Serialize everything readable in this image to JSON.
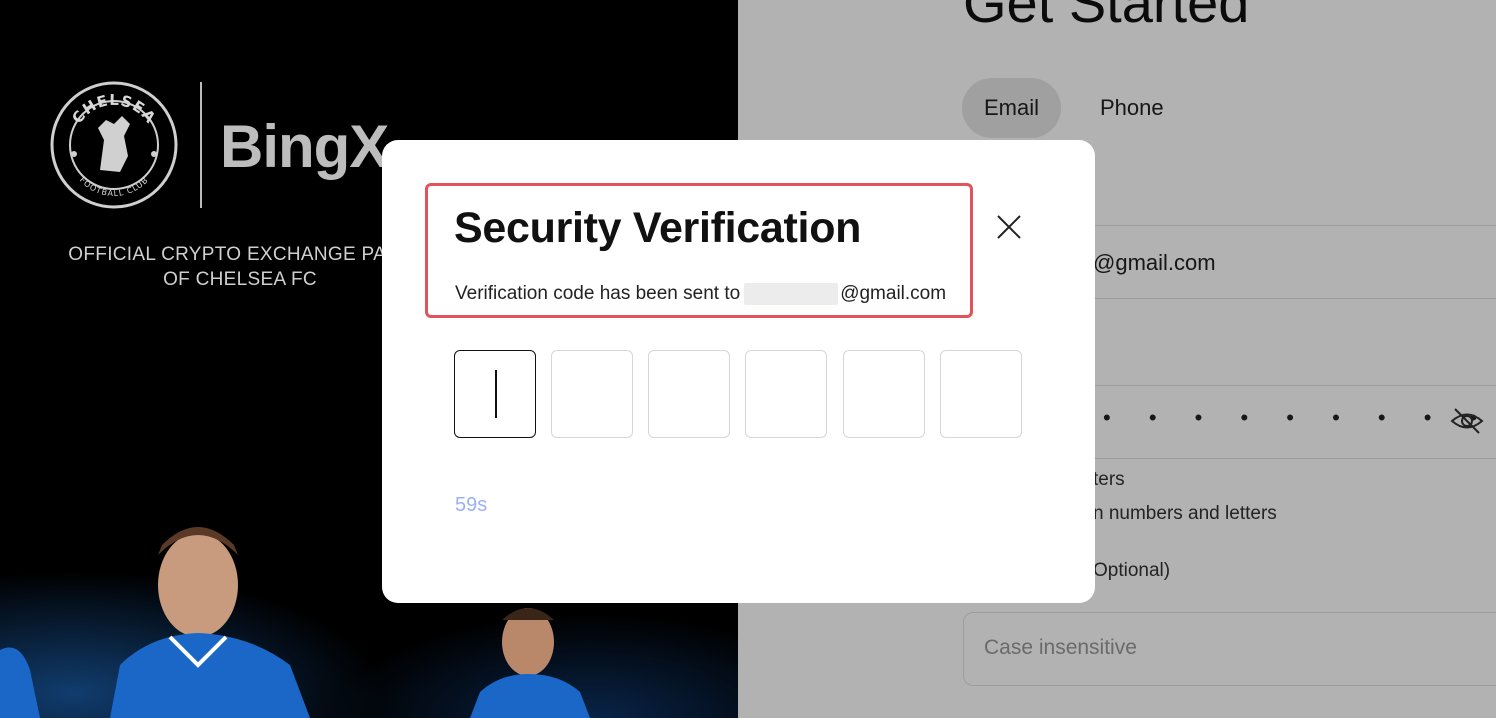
{
  "promo": {
    "brand_name": "BingX",
    "crest_text_top": "CHELSEA",
    "crest_text_bottom": "FOOTBALL CLUB",
    "partner_line1": "OFFICIAL CRYPTO EXCHANGE PART",
    "partner_line2": "OF CHELSEA FC"
  },
  "form": {
    "title": "Get Started",
    "tabs": [
      {
        "label": "Email",
        "selected": true
      },
      {
        "label": "Phone",
        "selected": false
      }
    ],
    "email_value_visible": "@gmail.com",
    "password_dots": "• • • • • • • • •",
    "hint1": "ters",
    "hint2": "n numbers and letters",
    "referral_label": "Optional)",
    "referral_placeholder": "Case insensitive"
  },
  "modal": {
    "title": "Security Verification",
    "subtitle_prefix": "Verification code has been sent to",
    "subtitle_suffix": "@gmail.com",
    "code_digits": [
      "",
      "",
      "",
      "",
      "",
      ""
    ],
    "active_index": 0,
    "timer": "59s",
    "highlight_color": "#e2545c",
    "timer_color": "#9bb1f4"
  },
  "icons": {
    "close": "close-icon",
    "eye": "eye-off-icon"
  }
}
